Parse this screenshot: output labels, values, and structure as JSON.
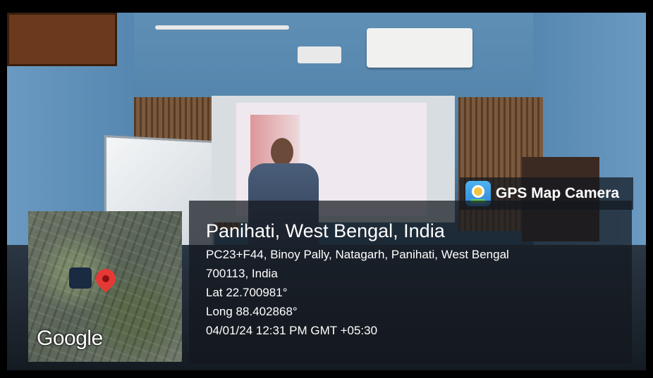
{
  "overlay": {
    "app_name": "GPS Map Camera",
    "map_label": "Google",
    "place": "Panihati, West Bengal, India",
    "address_line1": "PC23+F44, Binoy Pally, Natagarh, Panihati, West Bengal",
    "address_line2": "700113, India",
    "latitude": "Lat 22.700981°",
    "longitude": "Long 88.402868°",
    "datetime": "04/01/24 12:31 PM GMT +05:30"
  },
  "icons": [
    "gps-map-camera-app-icon",
    "map-location-pin-icon"
  ],
  "colors": {
    "overlay_bg": "#14181e",
    "pin": "#e53935",
    "text": "#ffffff"
  }
}
